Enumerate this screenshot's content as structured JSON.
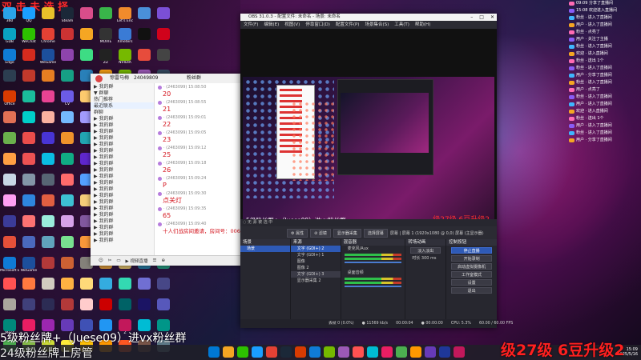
{
  "top_overlay": "双 击 未 选 择",
  "desktop_icons": [
    {
      "label": "360",
      "color": "#2aa3e8"
    },
    {
      "label": "QQ",
      "color": "#1a9fff"
    },
    {
      "label": "",
      "color": "#e8c12a"
    },
    {
      "label": "Steam",
      "color": "#1b2838"
    },
    {
      "label": "",
      "color": "#d94d8a"
    },
    {
      "label": "",
      "color": "#39b54a"
    },
    {
      "label": "Let's Enc",
      "color": "#f08b2c"
    },
    {
      "label": "",
      "color": "#4a90d9"
    },
    {
      "label": "",
      "color": "#7b4fd6"
    },
    {
      "label": "GDB",
      "color": "#0aa3c2"
    },
    {
      "label": "WeChat",
      "color": "#2dc100"
    },
    {
      "label": "Chrome",
      "color": "#e44134"
    },
    {
      "label": "",
      "color": "#c33"
    },
    {
      "label": "",
      "color": "#f5a623"
    },
    {
      "label": "MOVIE",
      "color": "#333"
    },
    {
      "label": "Xmeters",
      "color": "#3a7bd5"
    },
    {
      "label": "",
      "color": "#111"
    },
    {
      "label": "",
      "color": "#d0021b"
    },
    {
      "label": "Edge",
      "color": "#0f7bd6"
    },
    {
      "label": "",
      "color": "#d52b1e"
    },
    {
      "label": "WeGame",
      "color": "#1c4f9c"
    },
    {
      "label": "",
      "color": "#8e44ad"
    },
    {
      "label": "",
      "color": "#3ddc84"
    },
    {
      "label": "ZZ",
      "color": "#222"
    },
    {
      "label": "NVIDIA",
      "color": "#76b900"
    },
    {
      "label": "",
      "color": "#e74c3c"
    },
    {
      "label": "",
      "color": "#444"
    },
    {
      "label": "",
      "color": "#2c3e50"
    },
    {
      "label": "",
      "color": "#c0392b"
    },
    {
      "label": "",
      "color": "#e67e22"
    },
    {
      "label": "",
      "color": "#16a085"
    },
    {
      "label": "",
      "color": "#2980b9"
    },
    {
      "label": "",
      "color": "#f39c12"
    },
    {
      "label": "NVIDIA App",
      "color": "#76b900"
    },
    {
      "label": "",
      "color": "#9b59b6"
    },
    {
      "label": "",
      "color": "#34495e"
    },
    {
      "label": "Office",
      "color": "#d83b01"
    },
    {
      "label": "",
      "color": "#1abc9c"
    },
    {
      "label": "",
      "color": "#e84393"
    },
    {
      "label": "CV",
      "color": "#6c5ce7"
    },
    {
      "label": "",
      "color": "#fdcb6e"
    },
    {
      "label": "",
      "color": "#00b894"
    },
    {
      "label": "",
      "color": "#0984e3"
    },
    {
      "label": "",
      "color": "#d63031"
    },
    {
      "label": "",
      "color": "#636e72"
    },
    {
      "label": "",
      "color": "#e17055"
    },
    {
      "label": "",
      "color": "#00cec9"
    },
    {
      "label": "",
      "color": "#fab1a0"
    },
    {
      "label": "",
      "color": "#74b9ff"
    },
    {
      "label": "",
      "color": "#a29bfe"
    },
    {
      "label": "",
      "color": "#55efc4"
    },
    {
      "label": "",
      "color": "#ff7675"
    },
    {
      "label": "",
      "color": "#81ecec"
    },
    {
      "label": "",
      "color": "#b2bec3"
    },
    {
      "label": "",
      "color": "#6ab04c"
    },
    {
      "label": "",
      "color": "#eb4d4b"
    },
    {
      "label": "",
      "color": "#4834d4"
    },
    {
      "label": "",
      "color": "#f0932b"
    },
    {
      "label": "",
      "color": "#22a6b3"
    },
    {
      "label": "",
      "color": "#be2edd"
    },
    {
      "label": "",
      "color": "#130f40"
    },
    {
      "label": "",
      "color": "#535c68"
    },
    {
      "label": "",
      "color": "#95afc0"
    },
    {
      "label": "",
      "color": "#ff9f43"
    },
    {
      "label": "",
      "color": "#ee5253"
    },
    {
      "label": "",
      "color": "#0abde3"
    },
    {
      "label": "",
      "color": "#10ac84"
    },
    {
      "label": "",
      "color": "#5f27cd"
    },
    {
      "label": "",
      "color": "#222f3e"
    },
    {
      "label": "",
      "color": "#feca57"
    },
    {
      "label": "",
      "color": "#48dbfb"
    },
    {
      "label": "",
      "color": "#1dd1a1"
    },
    {
      "label": "",
      "color": "#c8d6e5"
    },
    {
      "label": "",
      "color": "#8395a7"
    },
    {
      "label": "",
      "color": "#576574"
    },
    {
      "label": "",
      "color": "#ff6b6b"
    },
    {
      "label": "",
      "color": "#54a0ff"
    },
    {
      "label": "",
      "color": "#5f27cd"
    },
    {
      "label": "",
      "color": "#01a3a4"
    },
    {
      "label": "",
      "color": "#f368e0"
    },
    {
      "label": "",
      "color": "#341f97"
    },
    {
      "label": "",
      "color": "#ff9ff3"
    },
    {
      "label": "",
      "color": "#2e86de"
    },
    {
      "label": "",
      "color": "#e15f41"
    },
    {
      "label": "",
      "color": "#3dc1d3"
    },
    {
      "label": "",
      "color": "#f5cd79"
    },
    {
      "label": "",
      "color": "#546de5"
    },
    {
      "label": "",
      "color": "#c44569"
    },
    {
      "label": "",
      "color": "#574b90"
    },
    {
      "label": "",
      "color": "#f78fb3"
    },
    {
      "label": "",
      "color": "#3b3b98"
    },
    {
      "label": "",
      "color": "#fd7272"
    },
    {
      "label": "",
      "color": "#9aecdb"
    },
    {
      "label": "",
      "color": "#d6a2e8"
    },
    {
      "label": "",
      "color": "#82589f"
    },
    {
      "label": "",
      "color": "#182c61"
    },
    {
      "label": "",
      "color": "#6a89cc"
    },
    {
      "label": "",
      "color": "#b8e994"
    },
    {
      "label": "",
      "color": "#079992"
    },
    {
      "label": "",
      "color": "#e55039"
    },
    {
      "label": "",
      "color": "#4a69bd"
    },
    {
      "label": "",
      "color": "#60a3bc"
    },
    {
      "label": "",
      "color": "#78e08f"
    },
    {
      "label": "",
      "color": "#fa983a"
    },
    {
      "label": "",
      "color": "#eb2f06"
    },
    {
      "label": "",
      "color": "#1e3799"
    },
    {
      "label": "",
      "color": "#3c6382"
    },
    {
      "label": "",
      "color": "#38ada9"
    },
    {
      "label": "Microsoft Edge",
      "color": "#0f7bd6"
    },
    {
      "label": "WeGame",
      "color": "#1c4f9c"
    },
    {
      "label": "",
      "color": "#b33939"
    },
    {
      "label": "",
      "color": "#cd6133"
    },
    {
      "label": "",
      "color": "#84817a"
    },
    {
      "label": "",
      "color": "#cc8e35"
    },
    {
      "label": "",
      "color": "#ccae62"
    },
    {
      "label": "",
      "color": "#227093"
    },
    {
      "label": "",
      "color": "#218c74"
    },
    {
      "label": "",
      "color": "#ff5252"
    },
    {
      "label": "",
      "color": "#ff793f"
    },
    {
      "label": "",
      "color": "#d1ccc0"
    },
    {
      "label": "",
      "color": "#ffb142"
    },
    {
      "label": "",
      "color": "#ffda79"
    },
    {
      "label": "",
      "color": "#34ace0"
    },
    {
      "label": "",
      "color": "#33d9b2"
    },
    {
      "label": "",
      "color": "#706fd3"
    },
    {
      "label": "",
      "color": "#474787"
    },
    {
      "label": "",
      "color": "#aaa69d"
    },
    {
      "label": "",
      "color": "#40407a"
    },
    {
      "label": "",
      "color": "#2c2c54"
    },
    {
      "label": "",
      "color": "#b33939"
    },
    {
      "label": "",
      "color": "#ffcccc"
    },
    {
      "label": "",
      "color": "#cc0000"
    },
    {
      "label": "",
      "color": "#006266"
    },
    {
      "label": "",
      "color": "#1b1464"
    },
    {
      "label": "",
      "color": "#5758bb"
    },
    {
      "label": "Meet",
      "color": "#00897b"
    },
    {
      "label": "",
      "color": "#e91e63"
    },
    {
      "label": "",
      "color": "#9c27b0"
    },
    {
      "label": "",
      "color": "#673ab7"
    },
    {
      "label": "",
      "color": "#3f51b5"
    },
    {
      "label": "",
      "color": "#2196f3"
    },
    {
      "label": "Z",
      "color": "#c2185b"
    },
    {
      "label": "",
      "color": "#00bcd4"
    },
    {
      "label": "",
      "color": "#009688"
    },
    {
      "label": "",
      "color": "#4caf50"
    },
    {
      "label": "",
      "color": "#8bc34a"
    },
    {
      "label": "",
      "color": "#cddc39"
    },
    {
      "label": "",
      "color": "#ffeb3b"
    },
    {
      "label": "",
      "color": "#ffc107"
    },
    {
      "label": "",
      "color": "#ff9800"
    },
    {
      "label": "",
      "color": "#ff5722"
    },
    {
      "label": "",
      "color": "#795548"
    },
    {
      "label": "",
      "color": "#607d8b"
    }
  ],
  "chat": {
    "title": "惊雷马梅",
    "id": "24049809",
    "tab": "粉丝群",
    "groups": [
      "▶ 我的群",
      "  ▼ 群聊",
      "  热门推荐",
      "  最近联系",
      "  群聊",
      "  ▶ 我的群",
      "  ▶ 我的群",
      "  ▶ 我的群",
      "  ▶ 我的群",
      "  ▶ 我的群",
      "  ▶ 我的群",
      "  ▶ 我的群",
      "  ▶ 我的群",
      "  ▶ 我的群",
      "  ▶ 我的群",
      "  ▶ 我的群",
      "  ▶ 我的群",
      "  ▶ 我的群",
      "  ▶ 我的群",
      "  ▶ 我的群",
      "  ▶ 我的群",
      "  ▶ 我的群",
      "  ▶ 我的群",
      "  ▶ 我的群",
      "  ▶ 我的群"
    ],
    "messages": [
      {
        "meta": "  ·  (2463099)  15:08:50",
        "text": "20"
      },
      {
        "meta": "  ·  (2463099)  15:08:55",
        "text": "21"
      },
      {
        "meta": "  ·  (2463099)  15:09:01",
        "text": "22"
      },
      {
        "meta": "  ·  (2463099)  15:09:05",
        "text": "23"
      },
      {
        "meta": "  ·  (2463099)  15:09:12",
        "text": "25"
      },
      {
        "meta": "  ·  (2463099)  15:09:18",
        "text": "26"
      },
      {
        "meta": "  ·  (2463099)  15:09:24",
        "text": "P"
      },
      {
        "meta": "  ·  (2463099)  15:09:30",
        "text": "点关灯"
      },
      {
        "meta": "  ·  (2463099)  15:09:35",
        "text": "65"
      },
      {
        "meta": "  ·  (2463099)  15:09:40",
        "text": "十人们战房间邀请，房间号：00650"
      }
    ],
    "bar": [
      "☺",
      "✂",
      "▭",
      "▶ 视频直播",
      "☰",
      "⊕"
    ]
  },
  "obs": {
    "title": "OBS 31.0.3 - 配置文件: 未命名 - 场景: 未命名",
    "menu": [
      "文件(F)",
      "编辑(E)",
      "视图(V)",
      "停靠窗口(D)",
      "配置文件(P)",
      "场景集合(S)",
      "工具(T)",
      "帮助(H)"
    ],
    "canvas_left": "5级粉丝群+（Juese09）进vx粉丝群",
    "canvas_right": "级27级 6豆升级2",
    "bar_text": "◌  无 源 被 选 中",
    "ctrl_buttons": [
      "⚙ 属性",
      "⊘ 滤镜",
      "显示器采集",
      "选择屏幕"
    ],
    "ctrl_scene": "屏幕 | 屏幕 1 (1920x1080 @ 0,0) 屏幕 (主显示器)",
    "docks": {
      "scenes": {
        "title": "场景",
        "items": [
          "场景"
        ]
      },
      "sources": {
        "title": "来源",
        "items": [
          "文字 (GDI+) 2",
          "文字 (GDI+) 1",
          "图像",
          "图像 2",
          "文字 (GDI+) 3",
          "显示器采集 2"
        ]
      },
      "mixer": {
        "title": "混音器",
        "items": [
          "麦克风/Aux",
          "桌面音频"
        ]
      },
      "transitions": {
        "title": "转场动画",
        "items": [
          "淡入淡出",
          "时长  300 ms"
        ]
      },
      "controls": {
        "title": "控制按钮",
        "items": [
          "停止直播",
          "开始录制",
          "启动虚拟摄像机",
          "工作室模式",
          "设置",
          "退出"
        ]
      }
    },
    "status": [
      "丢帧 0 (0.0%)",
      "● 11569 kb/s",
      "00:00:04",
      "● 00:00:00",
      "CPU: 5.3%",
      "60.00 / 60.00 FPS"
    ]
  },
  "right_panel": [
    "09:09  分享了直播间",
    "15:08  欢迎进入直播间",
    "  粉丝  ·  进入了直播间",
    "  用户  ·  进入了直播间",
    "  粉丝  ·  点亮了",
    "  用户  ·  关注了主播",
    "  粉丝  ·  进入了直播间",
    "  欢迎  ·  进入直播间",
    "  粉丝  ·  送出 1个",
    "  粉丝  ·  进入了直播间",
    "  用户  ·  分享了直播间",
    "  粉丝  ·  进入了直播间",
    "  用户  ·  点亮了",
    "  粉丝  ·  进入了直播间",
    "  用户  ·  进入了直播间",
    "  欢迎  ·  进入直播间",
    "  粉丝  ·  送出 1个",
    "  用户  ·  进入了直播间",
    "  粉丝  ·  进入了直播间",
    "  用户  ·  分享了直播间"
  ],
  "bottom_overlay": {
    "line1": "5级粉丝牌+（Juese09）进vx粉丝群",
    "line2": "24级粉丝牌上房管",
    "right": "级27级 6豆升级2"
  },
  "taskbar": {
    "icons": [
      "#0078d4",
      "#f5a623",
      "#2dc100",
      "#1a9fff",
      "#e44134",
      "#1b2838",
      "#d83b01",
      "#0f7bd6",
      "#76b900",
      "#9b59b6",
      "#ff5252",
      "#00bcd4",
      "#e91e63",
      "#4caf50",
      "#ff9800",
      "#673ab7",
      "#1e3799",
      "#c2185b"
    ],
    "time": "15:09",
    "date": "2025/5/16"
  }
}
